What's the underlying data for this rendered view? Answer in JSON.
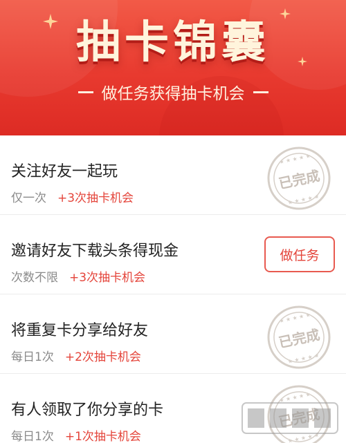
{
  "banner": {
    "title": "抽卡锦囊",
    "subtitle": "做任务获得抽卡机会"
  },
  "tasks": [
    {
      "title": "关注好友一起玩",
      "frequency": "仅一次",
      "reward": "+3次抽卡机会",
      "status": "completed",
      "status_label": "已完成"
    },
    {
      "title": "邀请好友下载头条得现金",
      "frequency": "次数不限",
      "reward": "+3次抽卡机会",
      "status": "todo",
      "button_label": "做任务"
    },
    {
      "title": "将重复卡分享给好友",
      "frequency": "每日1次",
      "reward": "+2次抽卡机会",
      "status": "completed",
      "status_label": "已完成"
    },
    {
      "title": "有人领取了你分享的卡",
      "frequency": "每日1次",
      "reward": "+1次抽卡机会",
      "status": "completed",
      "status_label": "已完成"
    }
  ],
  "colors": {
    "banner": "#e83a2f",
    "accent": "#e4443a",
    "stamp": "#c9c0b8"
  }
}
